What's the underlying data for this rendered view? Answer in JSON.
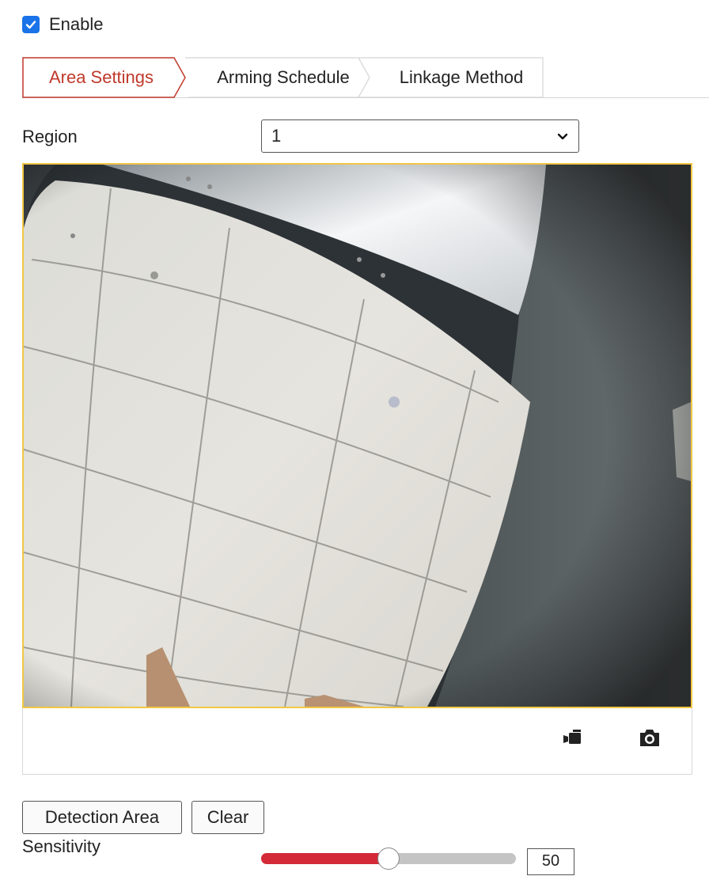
{
  "enable": {
    "label": "Enable",
    "checked": true
  },
  "tabs": [
    {
      "label": "Area Settings",
      "active": true
    },
    {
      "label": "Arming Schedule",
      "active": false
    },
    {
      "label": "Linkage Method",
      "active": false
    }
  ],
  "region": {
    "label": "Region",
    "value": "1"
  },
  "video": {
    "toolbar": [
      {
        "icon": "record-video-icon"
      },
      {
        "icon": "camera-snapshot-icon"
      }
    ]
  },
  "buttons": {
    "detection_area": "Detection Area",
    "clear": "Clear"
  },
  "sensitivity": {
    "label": "Sensitivity",
    "value": "50",
    "min": 0,
    "max": 100
  },
  "colors": {
    "accent": "#1a73e8",
    "active_tab": "#c0392b",
    "slider_fill": "#d42a37",
    "video_border": "#f2c744"
  }
}
